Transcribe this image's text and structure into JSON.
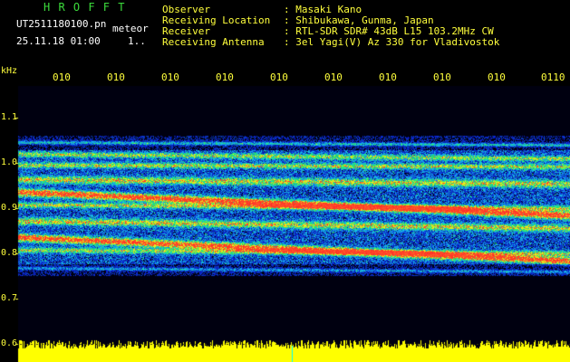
{
  "header": {
    "app_name": "H R O F F T",
    "filename": "UT2511180100.pn",
    "mode": "meteor",
    "datetime": "25.11.18 01:00",
    "page_marker": "1..",
    "info_labels": [
      "Observer",
      "Receiving Location",
      "Receiver",
      "Receiving Antenna"
    ],
    "info_values": [
      ": Masaki Kano",
      ": Shibukawa, Gunma, Japan",
      ": RTL-SDR SDR# 43dB L15 103.2MHz CW",
      ": 3el Yagi(V) Az 330 for Vladivostok"
    ]
  },
  "axes": {
    "y_unit": "kHz",
    "y_ticks": [
      "1.1",
      "1.0",
      "0.9",
      "0.8",
      "0.7",
      "0.6"
    ],
    "x_ticks": [
      "010",
      "010",
      "010",
      "010",
      "010",
      "010",
      "010",
      "010",
      "010",
      "0110"
    ]
  },
  "colors": {
    "text_yellow": "#ffff3c",
    "text_white": "#ffffff",
    "title_green": "#3cdc3c",
    "background": "#000000",
    "plot_bg": "#00005a",
    "strong_echo": "#ff3030",
    "amplitude_bar": "#ffff00"
  }
}
